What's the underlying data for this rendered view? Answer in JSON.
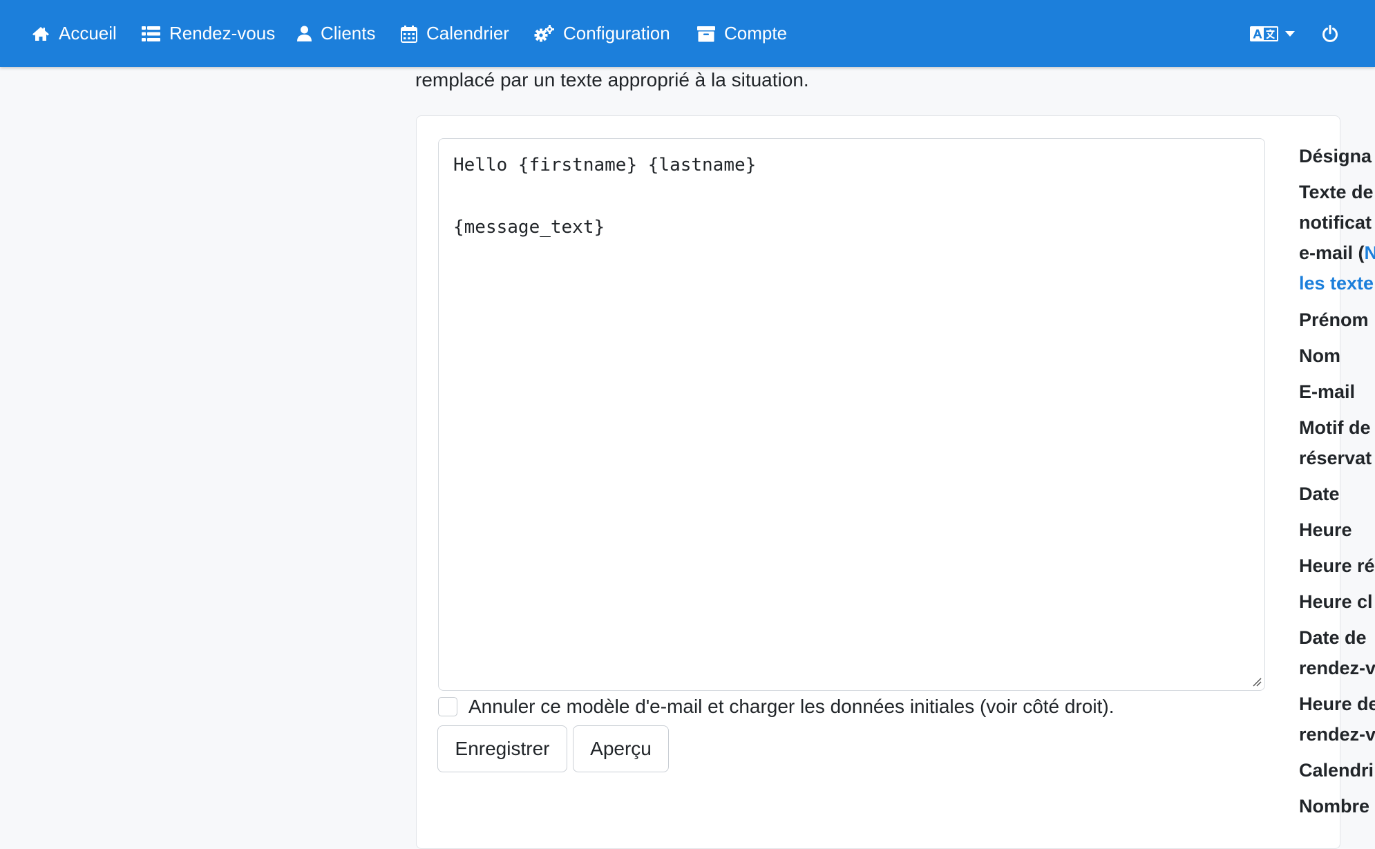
{
  "nav": {
    "home": "Accueil",
    "appointments": "Rendez-vous",
    "customers": "Clients",
    "calendar": "Calendrier",
    "configuration": "Configuration",
    "account": "Compte",
    "icons": [
      "home-icon",
      "list-icon",
      "user-icon",
      "calendar-icon",
      "cogs-icon",
      "archive-icon",
      "language-icon",
      "power-icon"
    ]
  },
  "intro": {
    "text": "remplacé par un texte approprié à la situation."
  },
  "editor": {
    "line1": "Hello {firstname} {lastname}",
    "line2": "",
    "line3": "{message_text}"
  },
  "reset": {
    "label": "Annuler ce modèle d'e-mail et charger les données initiales (voir côté droit).",
    "checked": false
  },
  "buttons": {
    "save": "Enregistrer",
    "preview": "Aperçu"
  },
  "fields": {
    "f1": "Désigna",
    "f2a": "Texte de",
    "f2b": "notificat",
    "f2c": "e-mail (",
    "f2c_link": "N",
    "f2d": "les texte",
    "f3": "Prénom",
    "f4": "Nom",
    "f5": "E-mail",
    "f6a": "Motif de",
    "f6b": "réservat",
    "f7": "Date",
    "f8": "Heure",
    "f9": "Heure ré",
    "f10": "Heure cl",
    "f11a": "Date de",
    "f11b": "rendez-v",
    "f12a": "Heure de",
    "f12b": "rendez-v",
    "f13": "Calendri",
    "f14": "Nombre"
  },
  "colors": {
    "navbar": "#1c7fdb",
    "link": "#1c7fdb",
    "background": "#f7f8fa"
  }
}
